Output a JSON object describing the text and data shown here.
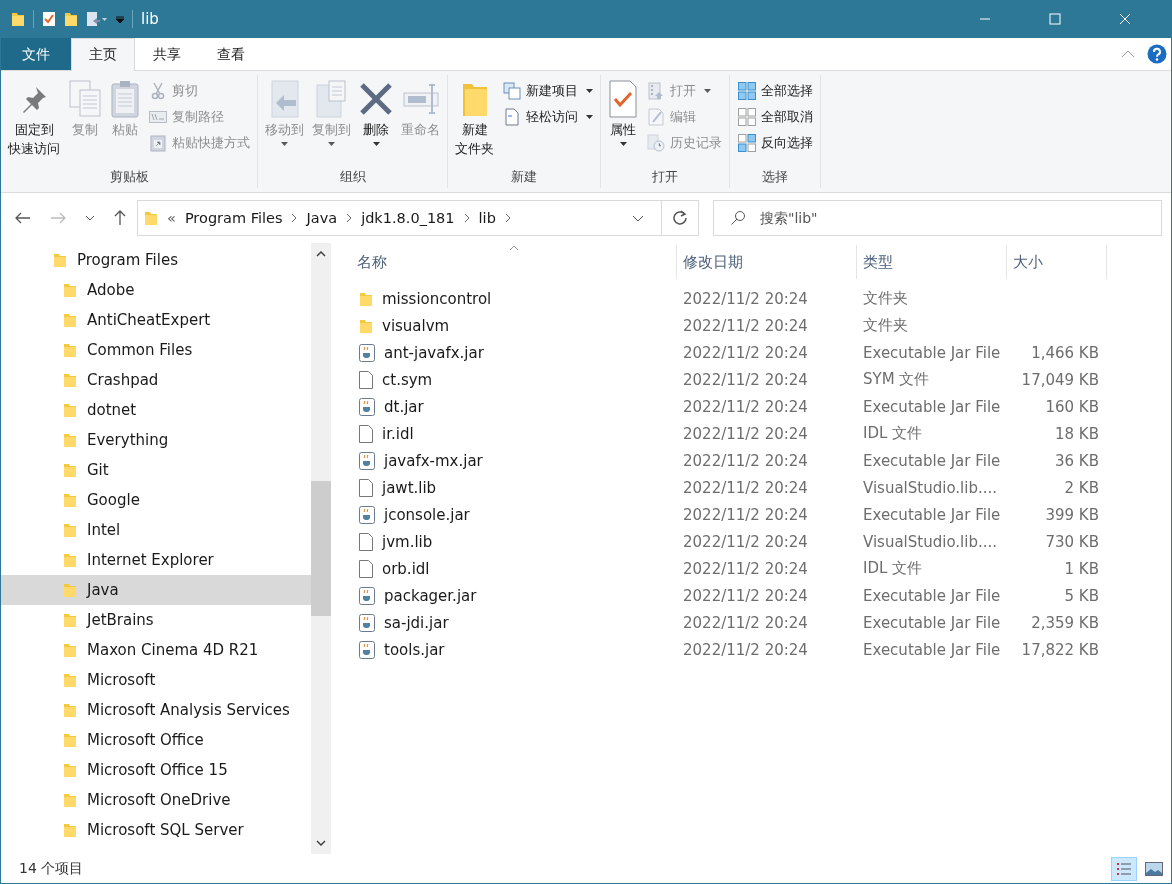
{
  "window": {
    "title": "lib"
  },
  "menu_tabs": [
    {
      "label": "文件",
      "kind": "file",
      "selected": false
    },
    {
      "label": "主页",
      "kind": "tab",
      "selected": true
    },
    {
      "label": "共享",
      "kind": "tab",
      "selected": false
    },
    {
      "label": "查看",
      "kind": "tab",
      "selected": false
    }
  ],
  "ribbon": {
    "groups": [
      {
        "label": "剪贴板",
        "items": [
          {
            "kind": "large",
            "lines": [
              "固定到",
              "快速访问"
            ],
            "disabled": false,
            "dropdown": false
          },
          {
            "kind": "large",
            "lines": [
              "复制"
            ],
            "disabled": true,
            "dropdown": false
          },
          {
            "kind": "large",
            "lines": [
              "粘贴"
            ],
            "disabled": true,
            "dropdown": false
          },
          {
            "kind": "small",
            "label": "剪切",
            "disabled": true,
            "dropdown": false
          },
          {
            "kind": "small",
            "label": "复制路径",
            "disabled": true,
            "dropdown": false
          },
          {
            "kind": "small",
            "label": "粘贴快捷方式",
            "disabled": true,
            "dropdown": false
          }
        ]
      },
      {
        "label": "组织",
        "items": [
          {
            "kind": "large",
            "lines": [
              "移动到"
            ],
            "disabled": true,
            "dropdown": true
          },
          {
            "kind": "large",
            "lines": [
              "复制到"
            ],
            "disabled": true,
            "dropdown": true
          },
          {
            "kind": "large",
            "lines": [
              "删除"
            ],
            "disabled": false,
            "dropdown": true
          },
          {
            "kind": "large",
            "lines": [
              "重命名"
            ],
            "disabled": true,
            "dropdown": false
          }
        ]
      },
      {
        "label": "新建",
        "items": [
          {
            "kind": "large",
            "lines": [
              "新建",
              "文件夹"
            ],
            "disabled": false,
            "dropdown": false
          },
          {
            "kind": "small",
            "label": "新建项目",
            "disabled": false,
            "dropdown": true
          },
          {
            "kind": "small",
            "label": "轻松访问",
            "disabled": false,
            "dropdown": true
          }
        ]
      },
      {
        "label": "打开",
        "items": [
          {
            "kind": "large",
            "lines": [
              "属性"
            ],
            "disabled": false,
            "dropdown": true
          },
          {
            "kind": "small",
            "label": "打开",
            "disabled": true,
            "dropdown": true
          },
          {
            "kind": "small",
            "label": "编辑",
            "disabled": true,
            "dropdown": false
          },
          {
            "kind": "small",
            "label": "历史记录",
            "disabled": true,
            "dropdown": false
          }
        ]
      },
      {
        "label": "选择",
        "items": [
          {
            "kind": "small",
            "label": "全部选择",
            "disabled": false,
            "dropdown": false
          },
          {
            "kind": "small",
            "label": "全部取消",
            "disabled": false,
            "dropdown": false
          },
          {
            "kind": "small",
            "label": "反向选择",
            "disabled": false,
            "dropdown": false
          }
        ]
      }
    ]
  },
  "address_bar": {
    "overflow": "«",
    "segments": [
      "Program Files",
      "Java",
      "jdk1.8.0_181",
      "lib"
    ]
  },
  "search": {
    "placeholder": "搜索\"lib\""
  },
  "navigation_tree": [
    {
      "label": "Program Files",
      "selected": false,
      "children": [
        {
          "label": "Adobe",
          "selected": false
        },
        {
          "label": "AntiCheatExpert",
          "selected": false
        },
        {
          "label": "Common Files",
          "selected": false
        },
        {
          "label": "Crashpad",
          "selected": false
        },
        {
          "label": "dotnet",
          "selected": false
        },
        {
          "label": "Everything",
          "selected": false
        },
        {
          "label": "Git",
          "selected": false
        },
        {
          "label": "Google",
          "selected": false
        },
        {
          "label": "Intel",
          "selected": false
        },
        {
          "label": "Internet Explorer",
          "selected": false
        },
        {
          "label": "Java",
          "selected": true
        },
        {
          "label": "JetBrains",
          "selected": false
        },
        {
          "label": "Maxon Cinema 4D R21",
          "selected": false
        },
        {
          "label": "Microsoft",
          "selected": false
        },
        {
          "label": "Microsoft Analysis Services",
          "selected": false
        },
        {
          "label": "Microsoft Office",
          "selected": false
        },
        {
          "label": "Microsoft Office 15",
          "selected": false
        },
        {
          "label": "Microsoft OneDrive",
          "selected": false
        },
        {
          "label": "Microsoft SQL Server",
          "selected": false
        }
      ]
    }
  ],
  "file_list": {
    "columns": [
      "名称",
      "修改日期",
      "类型",
      "大小"
    ],
    "rows": [
      {
        "kind": "folder",
        "name": "missioncontrol",
        "modified": "2022/11/2 20:24",
        "type": "文件夹"
      },
      {
        "kind": "folder",
        "name": "visualvm",
        "modified": "2022/11/2 20:24",
        "type": "文件夹"
      },
      {
        "kind": "jar",
        "name": "ant-javafx.jar",
        "modified": "2022/11/2 20:24",
        "type": "Executable Jar File",
        "size": "1,466 KB"
      },
      {
        "kind": "file",
        "name": "ct.sym",
        "modified": "2022/11/2 20:24",
        "type": "SYM 文件",
        "size": "17,049 KB"
      },
      {
        "kind": "jar",
        "name": "dt.jar",
        "modified": "2022/11/2 20:24",
        "type": "Executable Jar File",
        "size": "160 KB"
      },
      {
        "kind": "file",
        "name": "ir.idl",
        "modified": "2022/11/2 20:24",
        "type": "IDL 文件",
        "size": "18 KB"
      },
      {
        "kind": "jar",
        "name": "javafx-mx.jar",
        "modified": "2022/11/2 20:24",
        "type": "Executable Jar File",
        "size": "36 KB"
      },
      {
        "kind": "file",
        "name": "jawt.lib",
        "modified": "2022/11/2 20:24",
        "type": "VisualStudio.lib....",
        "size": "2 KB"
      },
      {
        "kind": "jar",
        "name": "jconsole.jar",
        "modified": "2022/11/2 20:24",
        "type": "Executable Jar File",
        "size": "399 KB"
      },
      {
        "kind": "file",
        "name": "jvm.lib",
        "modified": "2022/11/2 20:24",
        "type": "VisualStudio.lib....",
        "size": "730 KB"
      },
      {
        "kind": "file",
        "name": "orb.idl",
        "modified": "2022/11/2 20:24",
        "type": "IDL 文件",
        "size": "1 KB"
      },
      {
        "kind": "jar",
        "name": "packager.jar",
        "modified": "2022/11/2 20:24",
        "type": "Executable Jar File",
        "size": "5 KB"
      },
      {
        "kind": "jar",
        "name": "sa-jdi.jar",
        "modified": "2022/11/2 20:24",
        "type": "Executable Jar File",
        "size": "2,359 KB"
      },
      {
        "kind": "jar",
        "name": "tools.jar",
        "modified": "2022/11/2 20:24",
        "type": "Executable Jar File",
        "size": "17,822 KB"
      }
    ]
  },
  "status_bar": {
    "item_count": "14 个项目",
    "views": [
      {
        "kind": "details",
        "selected": true
      },
      {
        "kind": "thumbnails",
        "selected": false
      }
    ]
  }
}
